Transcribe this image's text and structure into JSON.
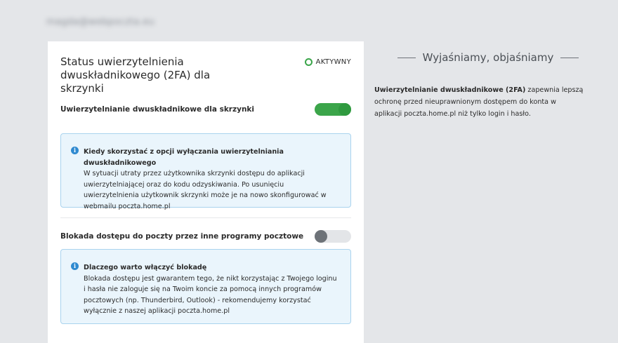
{
  "header": {
    "email": "magda@webpoczta.eu"
  },
  "card": {
    "title": "Status uwierzytelnienia dwuskładnikowego (2FA) dla skrzynki",
    "status_label": "AKTYWNY",
    "status_color": "#3ba54a",
    "twofa": {
      "label": "Uwierzytelnianie dwuskładnikowe dla skrzynki",
      "enabled": true
    },
    "twofa_info": {
      "icon": "info-icon",
      "title": "Kiedy skorzystać z opcji wyłączania uwierzytelniania dwuskładnikowego",
      "body": "W sytuacji utraty przez użytkownika skrzynki dostępu do aplikacji uwierzytelniającej oraz do kodu odzyskiwania. Po usunięciu uwierzytelnienia użytkownik skrzynki może je na nowo skonfigurować w webmailu poczta.home.pl"
    },
    "block": {
      "label": "Blokada dostępu do poczty przez inne programy pocztowe",
      "enabled": false
    },
    "block_info": {
      "icon": "info-icon",
      "title": "Dlaczego warto włączyć blokadę",
      "body": "Blokada dostępu jest gwarantem tego, że nikt korzystając z Twojego loginu i hasła nie zaloguje się na Twoim koncie za pomocą innych programów pocztowych (np. Thunderbird, Outlook) - rekomendujemy korzystać wyłącznie z naszej aplikacji poczta.home.pl"
    }
  },
  "sidebar": {
    "heading": "Wyjaśniamy, objaśniamy",
    "text_bold": "Uwierzytelnianie dwuskładnikowe (2FA)",
    "text_rest": " zapewnia lepszą ochronę przed nieuprawnionym dostępem do konta w aplikacji poczta.home.pl niż tylko login i hasło."
  },
  "colors": {
    "accent_green": "#3ba54a",
    "info_blue": "#2f8ad0",
    "info_bg": "#eaf5fc"
  }
}
